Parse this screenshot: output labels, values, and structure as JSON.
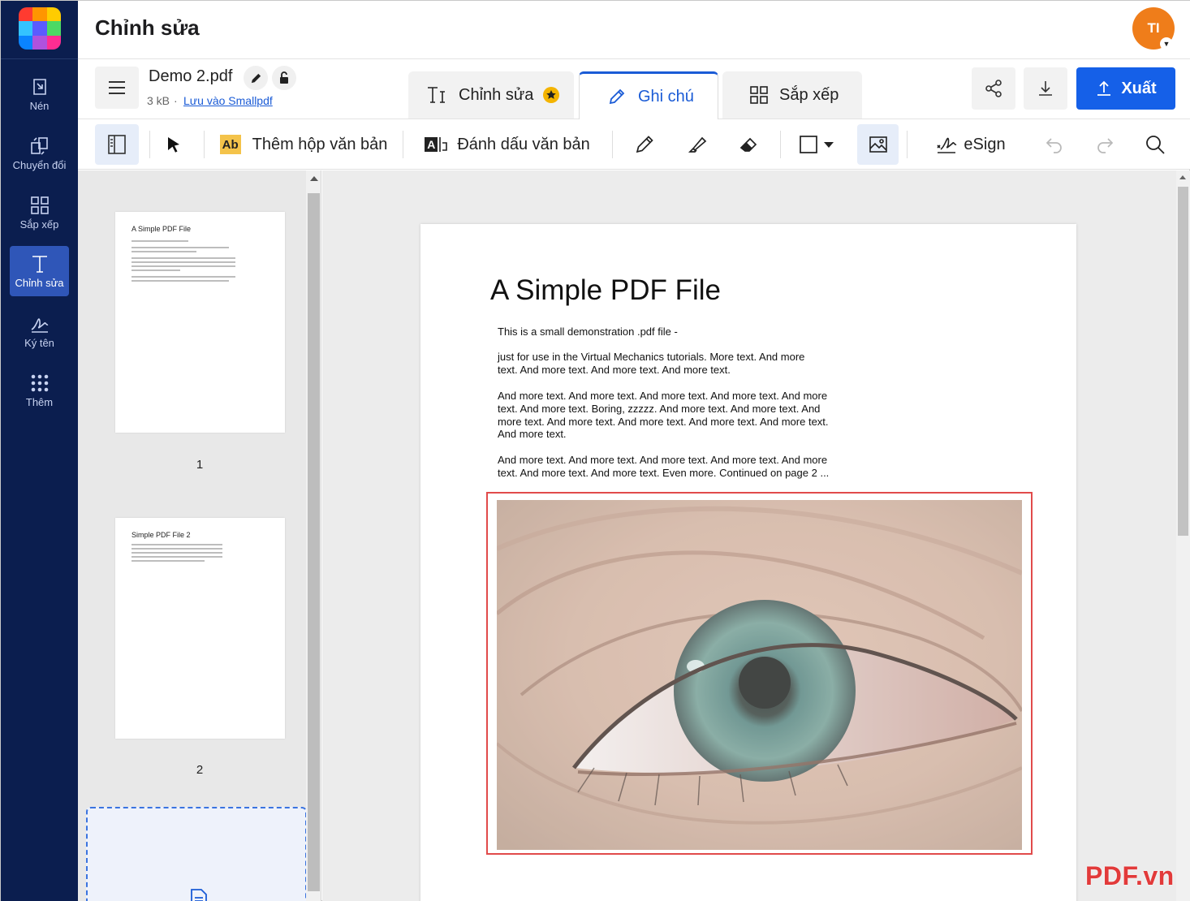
{
  "app": {
    "title": "Chỉnh sửa",
    "avatar_initials": "TI"
  },
  "sidebar": {
    "items": [
      {
        "label": "Nén",
        "icon": "compress-icon"
      },
      {
        "label": "Chuyển đổi",
        "icon": "convert-icon"
      },
      {
        "label": "Sắp xếp",
        "icon": "grid-icon"
      },
      {
        "label": "Chỉnh sửa",
        "icon": "text-edit-icon",
        "active": true
      },
      {
        "label": "Ký tên",
        "icon": "signature-icon"
      },
      {
        "label": "Thêm",
        "icon": "dots-grid-icon"
      }
    ]
  },
  "file": {
    "name": "Demo 2.pdf",
    "size": "3 kB",
    "separator": "·",
    "save_link": "Lưu vào Smallpdf"
  },
  "tabs": [
    {
      "label": "Chỉnh sửa",
      "premium": true
    },
    {
      "label": "Ghi chú",
      "active": true
    },
    {
      "label": "Sắp xếp"
    }
  ],
  "actions": {
    "export_label": "Xuất"
  },
  "toolbar": {
    "add_textbox": "Thêm hộp văn bản",
    "add_textbox_badge": "Ab",
    "highlight_text": "Đánh dấu văn bản",
    "highlight_badge": "A",
    "esign": "eSign"
  },
  "thumbnails": [
    {
      "page": "1",
      "title": "A Simple PDF File"
    },
    {
      "page": "2",
      "title": "Simple PDF File 2"
    }
  ],
  "document": {
    "title": "A Simple PDF File",
    "paragraphs": [
      "This is a small demonstration .pdf file -",
      "just for use in the Virtual Mechanics tutorials. More text. And more text. And more text. And more text. And more text.",
      "And more text. And more text. And more text. And more text. And more text. And more text. Boring, zzzzz. And more text. And more text. And more text. And more text. And more text. And more text. And more text. And more text.",
      "And more text. And more text. And more text. And more text. And more text. And more text. And more text. Even more. Continued on page 2 ..."
    ]
  },
  "watermark": "PDF.vn",
  "colors": {
    "rail": "#0b1e4f",
    "accent": "#1560e8",
    "selection": "#e14b4b",
    "avatar": "#ef7d1a"
  }
}
